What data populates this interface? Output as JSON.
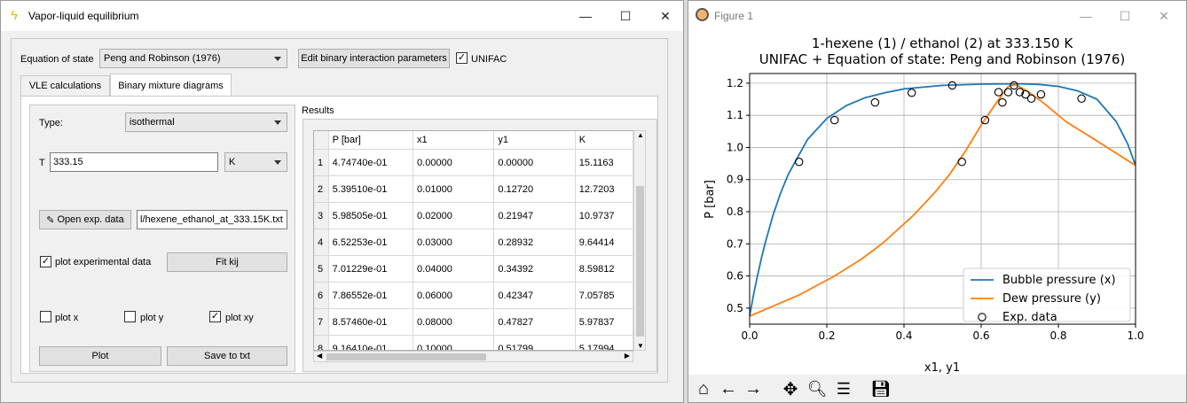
{
  "vle_window": {
    "title": "Vapor-liquid equilibrium",
    "eos_label": "Equation of state",
    "eos_value": "Peng and Robinson (1976)",
    "edit_bip_label": "Edit binary interaction parameters",
    "unifac_label": "UNIFAC",
    "unifac_checked": true,
    "tabs": [
      "VLE calculations",
      "Binary mixture diagrams"
    ],
    "type_label": "Type:",
    "type_value": "isothermal",
    "t_label": "T",
    "t_value": "333.15",
    "t_unit": "K",
    "open_exp_label": "Open exp. data",
    "file_path": "l/hexene_ethanol_at_333.15K.txt",
    "plot_exp_label": "plot experimental data",
    "fit_kij_label": "Fit kij",
    "plot_x_label": "plot x",
    "plot_y_label": "plot y",
    "plot_xy_label": "plot xy",
    "plot_label": "Plot",
    "save_label": "Save to txt",
    "results_label": "Results",
    "table": {
      "columns": [
        "P [bar]",
        "x1",
        "y1",
        "K"
      ],
      "rows": [
        [
          "1",
          "4.74740e-01",
          "0.00000",
          "0.00000",
          "15.1163"
        ],
        [
          "2",
          "5.39510e-01",
          "0.01000",
          "0.12720",
          "12.7203"
        ],
        [
          "3",
          "5.98505e-01",
          "0.02000",
          "0.21947",
          "10.9737"
        ],
        [
          "4",
          "6.52253e-01",
          "0.03000",
          "0.28932",
          "9.64414"
        ],
        [
          "5",
          "7.01229e-01",
          "0.04000",
          "0.34392",
          "8.59812"
        ],
        [
          "6",
          "7.86552e-01",
          "0.06000",
          "0.42347",
          "7.05785"
        ],
        [
          "7",
          "8.57460e-01",
          "0.08000",
          "0.47827",
          "5.97837"
        ],
        [
          "8",
          "9.16410e-01",
          "0.10000",
          "0.51799",
          "5.17994"
        ]
      ]
    }
  },
  "figure_window": {
    "title": "Figure 1"
  },
  "colors": {
    "bubble": "#1f77b4",
    "dew": "#ff7f0e"
  },
  "chart_data": {
    "type": "line",
    "title": "1-hexene (1) / ethanol (2) at 333.150 K",
    "subtitle": "UNIFAC + Equation of state: Peng and Robinson (1976)",
    "xlabel": "x1, y1",
    "ylabel": "P [bar]",
    "xlim": [
      0.0,
      1.0
    ],
    "ylim": [
      0.45,
      1.23
    ],
    "xticks": [
      "0.0",
      "0.2",
      "0.4",
      "0.6",
      "0.8",
      "1.0"
    ],
    "yticks": [
      "0.5",
      "0.6",
      "0.7",
      "0.8",
      "0.9",
      "1.0",
      "1.1",
      "1.2"
    ],
    "grid": true,
    "legend_position": "lower-right",
    "series": [
      {
        "name": "Bubble pressure (x)",
        "x": [
          0.0,
          0.01,
          0.02,
          0.03,
          0.04,
          0.06,
          0.08,
          0.1,
          0.15,
          0.2,
          0.25,
          0.3,
          0.35,
          0.4,
          0.5,
          0.6,
          0.7,
          0.75,
          0.8,
          0.85,
          0.9,
          0.95,
          0.98,
          1.0
        ],
        "y": [
          0.475,
          0.54,
          0.599,
          0.652,
          0.701,
          0.787,
          0.857,
          0.916,
          1.025,
          1.09,
          1.13,
          1.155,
          1.17,
          1.182,
          1.193,
          1.197,
          1.198,
          1.196,
          1.19,
          1.176,
          1.15,
          1.08,
          1.01,
          0.944
        ]
      },
      {
        "name": "Dew pressure (y)",
        "x": [
          0.0,
          0.127,
          0.219,
          0.289,
          0.344,
          0.423,
          0.478,
          0.518,
          0.56,
          0.6,
          0.64,
          0.67,
          0.69,
          0.72,
          0.76,
          0.82,
          0.9,
          1.0
        ],
        "y": [
          0.475,
          0.54,
          0.599,
          0.652,
          0.701,
          0.787,
          0.857,
          0.916,
          0.99,
          1.07,
          1.14,
          1.19,
          1.195,
          1.175,
          1.14,
          1.08,
          1.02,
          0.944
        ]
      },
      {
        "name": "Exp. data",
        "x": [
          0.128,
          0.22,
          0.325,
          0.42,
          0.525,
          0.55,
          0.61,
          0.645,
          0.655,
          0.67,
          0.685,
          0.7,
          0.715,
          0.73,
          0.755,
          0.86
        ],
        "y": [
          0.955,
          1.085,
          1.14,
          1.17,
          1.193,
          0.955,
          1.085,
          1.172,
          1.14,
          1.172,
          1.193,
          1.172,
          1.165,
          1.152,
          1.165,
          1.152
        ]
      }
    ]
  }
}
